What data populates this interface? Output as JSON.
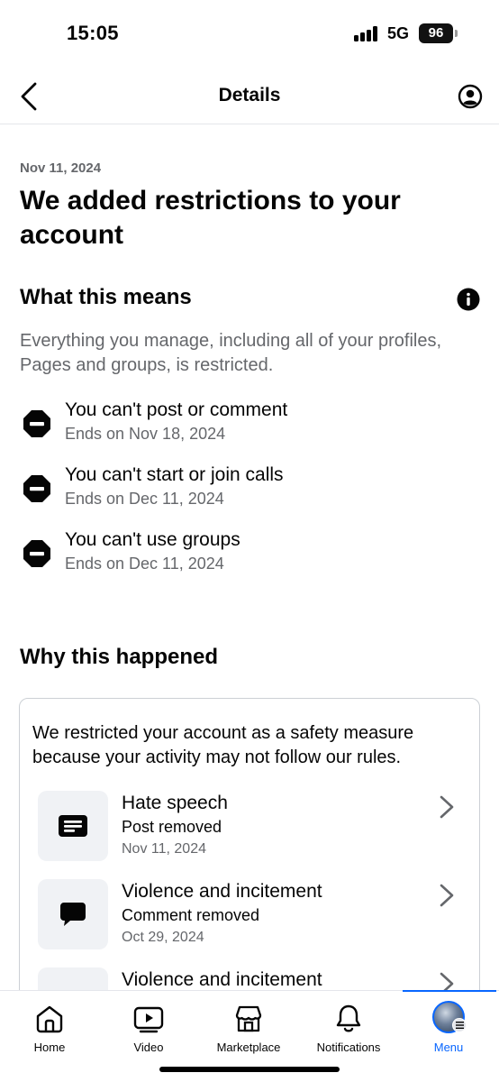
{
  "status_bar": {
    "time": "15:05",
    "network": "5G",
    "battery": "96"
  },
  "header": {
    "title": "Details"
  },
  "notice": {
    "date": "Nov 11, 2024",
    "title": "We added restrictions to your account"
  },
  "what_this_means": {
    "heading": "What this means",
    "description": "Everything you manage, including all of your profiles, Pages and groups, is restricted.",
    "restrictions": [
      {
        "title": "You can't post or comment",
        "ends": "Ends on Nov 18, 2024"
      },
      {
        "title": "You can't start or join calls",
        "ends": "Ends on Dec 11, 2024"
      },
      {
        "title": "You can't use groups",
        "ends": "Ends on Dec 11, 2024"
      }
    ]
  },
  "why_this_happened": {
    "heading": "Why this happened",
    "explanation": "We restricted your account as a safety measure because your activity may not follow our rules.",
    "violations": [
      {
        "title": "Hate speech",
        "action": "Post removed",
        "date": "Nov 11, 2024",
        "icon": "post-icon"
      },
      {
        "title": "Violence and incitement",
        "action": "Comment removed",
        "date": "Oct 29, 2024",
        "icon": "comment-icon"
      },
      {
        "title": "Violence and incitement",
        "action": "",
        "date": "",
        "icon": "post-icon"
      }
    ]
  },
  "bottom_nav": {
    "items": [
      {
        "label": "Home",
        "icon": "home-icon"
      },
      {
        "label": "Video",
        "icon": "video-icon"
      },
      {
        "label": "Marketplace",
        "icon": "marketplace-icon"
      },
      {
        "label": "Notifications",
        "icon": "bell-icon"
      },
      {
        "label": "Menu",
        "icon": "avatar"
      }
    ],
    "active": "Menu"
  },
  "colors": {
    "accent": "#0866ff",
    "secondary_text": "#65676b",
    "thumb_bg": "#f0f2f5"
  }
}
